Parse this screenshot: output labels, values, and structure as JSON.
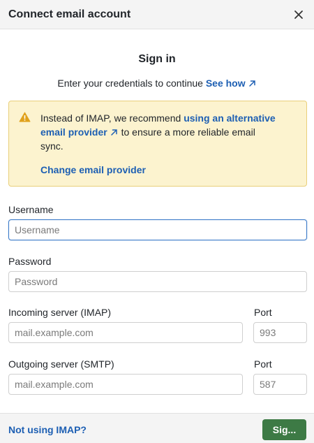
{
  "header": {
    "title": "Connect email account"
  },
  "signin": {
    "title": "Sign in",
    "subtitle_text": "Enter your credentials to continue",
    "see_how_link": "See how"
  },
  "warning": {
    "text_before": "Instead of IMAP, we recommend ",
    "link_text": "using an alternative email provider",
    "text_after": " to ensure a more reliable email sync.",
    "change_provider_link": "Change email provider"
  },
  "form": {
    "username": {
      "label": "Username",
      "placeholder": "Username",
      "value": ""
    },
    "password": {
      "label": "Password",
      "placeholder": "Password",
      "value": ""
    },
    "incoming": {
      "label": "Incoming server (IMAP)",
      "placeholder": "mail.example.com",
      "port_label": "Port",
      "port_placeholder": "993"
    },
    "outgoing": {
      "label": "Outgoing server (SMTP)",
      "placeholder": "mail.example.com",
      "port_label": "Port",
      "port_placeholder": "587"
    }
  },
  "footer": {
    "not_imap_link": "Not using IMAP?",
    "sign_in_button": "Sig..."
  },
  "colors": {
    "link": "#1d5fb3",
    "warning_bg": "#fcf3cf",
    "warning_icon": "#e0a11b",
    "primary_button": "#3d7a45"
  },
  "icons": {
    "close": "close-icon",
    "external": "external-link-icon",
    "warning": "warning-icon"
  }
}
